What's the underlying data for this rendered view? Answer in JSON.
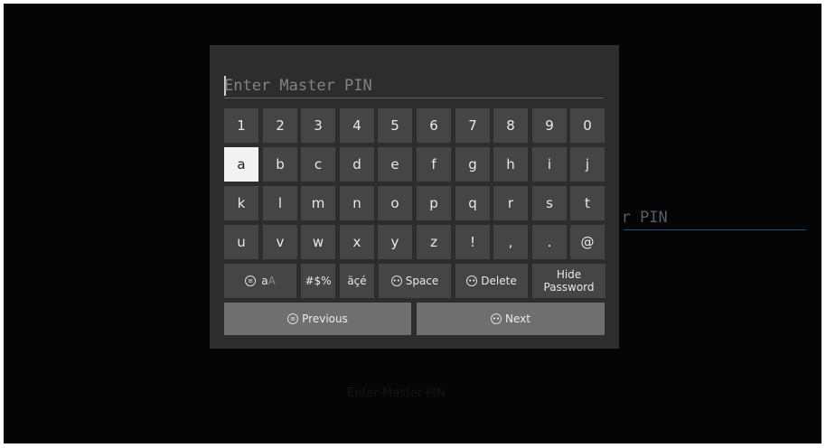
{
  "background": {
    "field_text": "Enter Master PIN",
    "faint_text": "Enter Master PIN"
  },
  "keyboard": {
    "input_placeholder": "Enter Master PIN",
    "rows": [
      [
        "1",
        "2",
        "3",
        "4",
        "5",
        "6",
        "7",
        "8",
        "9",
        "0"
      ],
      [
        "a",
        "b",
        "c",
        "d",
        "e",
        "f",
        "g",
        "h",
        "i",
        "j"
      ],
      [
        "k",
        "l",
        "m",
        "n",
        "o",
        "p",
        "q",
        "r",
        "s",
        "t"
      ],
      [
        "u",
        "v",
        "w",
        "x",
        "y",
        "z",
        "!",
        ",",
        ".",
        "@"
      ]
    ],
    "selected_key": "a",
    "function_keys": {
      "case_lower": "a",
      "case_upper": "A",
      "symbols": "#$%",
      "accents": "äçé",
      "space": "Space",
      "delete": "Delete",
      "hide_password_line1": "Hide",
      "hide_password_line2": "Password"
    },
    "nav": {
      "previous": "Previous",
      "next": "Next"
    }
  },
  "colors": {
    "panel_bg": "#2d2d2d",
    "key_bg": "#454545",
    "selected_key_bg": "#f2f2f2",
    "nav_bg": "#6f6f6f",
    "focus_underline": "#1f4d77"
  }
}
